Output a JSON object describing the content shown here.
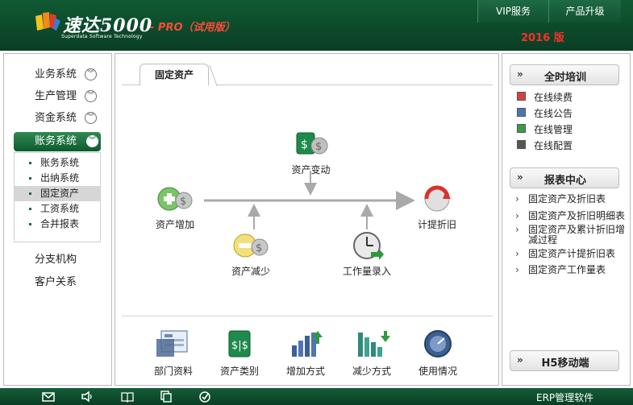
{
  "header": {
    "brand_name": "速达5000",
    "brand_edition": "- PRO（试用版）",
    "brand_en": "Superdata Software Technology",
    "links": [
      "VIP服务",
      "产品升级"
    ],
    "version": "2016 版"
  },
  "sidebar": {
    "menu_items": [
      "业务系统",
      "生产管理",
      "资金系统"
    ],
    "active_item": "账务系统",
    "sub_items": [
      "账务系统",
      "出纳系统",
      "固定资产",
      "工资系统",
      "合并报表"
    ],
    "selected_sub": "固定资产",
    "other_items": [
      "分支机构",
      "客户关系"
    ]
  },
  "main": {
    "tab": "固定资产",
    "flow_nodes": {
      "change": "资产变动",
      "add": "资产增加",
      "depreciation": "计提折旧",
      "reduce": "资产减少",
      "workload": "工作量录入"
    },
    "bottom_items": [
      "部门资料",
      "资产类别",
      "增加方式",
      "减少方式",
      "使用情况"
    ]
  },
  "right_panel": {
    "training_title": "全时培训",
    "online_items": [
      "在线续费",
      "在线公告",
      "在线管理",
      "在线配置"
    ],
    "report_title": "报表中心",
    "report_items": [
      "固定资产及折旧表",
      "固定资产及折旧明细表",
      "固定资产及累计折旧增减过程",
      "固定资产计提折旧表",
      "固定资产工作量表"
    ],
    "mobile_title": "H5移动端"
  },
  "footer": {
    "text": "ERP管理软件",
    "icons": [
      "mail-icon",
      "speaker-icon",
      "book-icon",
      "copy-icon",
      "check-icon"
    ]
  },
  "colors": {
    "header_green": "#0f5a33",
    "active_green": "#2f8a52",
    "version_red": "#ff2e2e",
    "edition_red": "#ff4a3a"
  }
}
